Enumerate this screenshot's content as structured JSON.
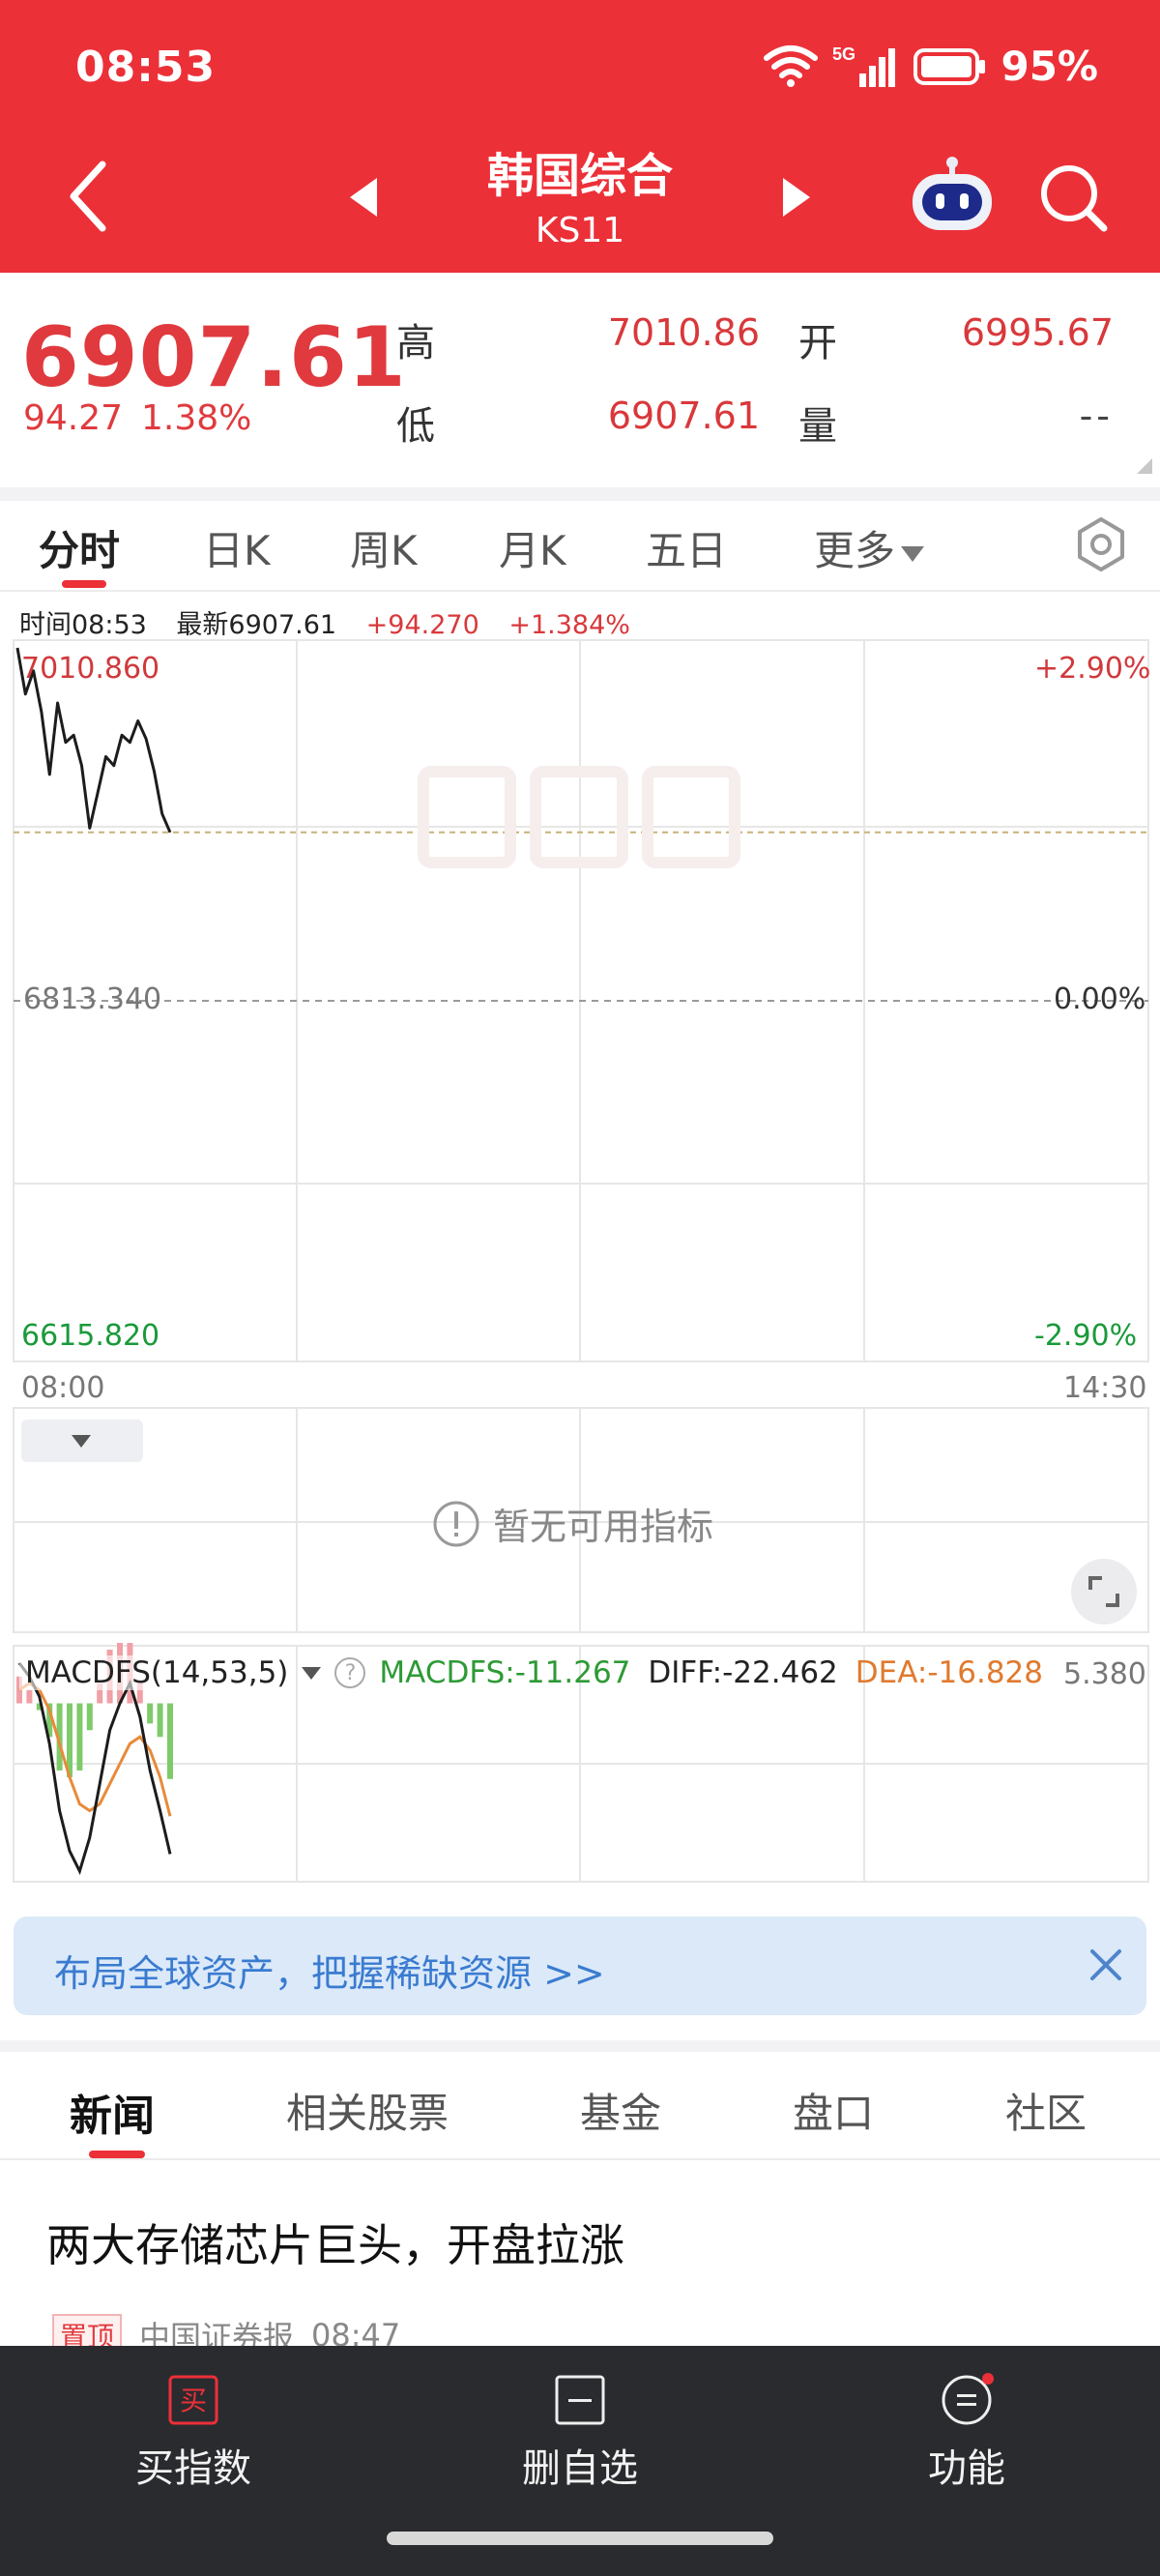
{
  "status_bar": {
    "time": "08:53",
    "network": "5G",
    "battery": "95%"
  },
  "header": {
    "title": "韩国综合",
    "code": "KS11"
  },
  "quote": {
    "price": "6907.61",
    "change": "94.27",
    "change_pct": "1.38%",
    "high_label": "高",
    "high": "7010.86",
    "low_label": "低",
    "low": "6907.61",
    "open_label": "开",
    "open": "6995.67",
    "volume_label": "量",
    "volume": "--"
  },
  "chart_tabs": [
    "分时",
    "日K",
    "周K",
    "月K",
    "五日",
    "更多"
  ],
  "info_line": {
    "time": "时间08:53",
    "latest": "最新6907.61",
    "change": "+94.270",
    "change_pct": "+1.384%"
  },
  "chart_data": {
    "type": "line",
    "title": "",
    "x_axis": {
      "start": "08:00",
      "end": "14:30"
    },
    "y_axis": {
      "max": "7010.860",
      "mid": "6813.340",
      "min": "6615.820"
    },
    "pct_axis": {
      "max": "+2.90%",
      "mid": "0.00%",
      "min": "-2.90%"
    },
    "ylim": [
      6615.82,
      7010.86
    ],
    "series": [
      {
        "values": [
          7010.86,
          6985,
          6998,
          6975,
          6940,
          6980,
          6958,
          6962,
          6945,
          6910,
          6930,
          6950,
          6945,
          6962,
          6958,
          6970,
          6960,
          6942,
          6918,
          6907.61
        ]
      }
    ],
    "macd": {
      "diff": [
        6,
        4,
        1,
        -6,
        -16,
        -22,
        -25,
        -20,
        -12,
        -4,
        0,
        3,
        -2,
        -10,
        -16,
        -22.462
      ],
      "dea": [
        2,
        3,
        2,
        -1,
        -6,
        -11,
        -15,
        -16,
        -15,
        -12,
        -9,
        -6,
        -5,
        -7,
        -11,
        -16.828
      ],
      "bars": [
        4,
        2,
        -1,
        -5,
        -10,
        -11,
        -10,
        -4,
        3,
        8,
        9,
        9,
        3,
        -3,
        -5,
        -11.267
      ]
    }
  },
  "volume_panel": {
    "empty_text": "暂无可用指标"
  },
  "macd_panel": {
    "name": "MACDFS(14,53,5)",
    "macdfs": "MACDFS:-11.267",
    "diff": "DIFF:-22.462",
    "dea": "DEA:-16.828",
    "scale_top": "5.380"
  },
  "banner": {
    "text": "布局全球资产，把握稀缺资源  >>"
  },
  "news_tabs": [
    "新闻",
    "相关股票",
    "基金",
    "盘口",
    "社区"
  ],
  "news": {
    "title": "两大存储芯片巨头，开盘拉涨",
    "tag": "置顶",
    "source": "中国证券报",
    "time": "08:47"
  },
  "bottom_bar": {
    "buy": "买指数",
    "buy_icon_char": "买",
    "remove": "删自选",
    "function": "功能"
  },
  "colors": {
    "brand_red": "#ec3038",
    "up_red": "#d9383b",
    "down_green": "#1a9a3a",
    "banner_blue": "#3a7bd0"
  }
}
